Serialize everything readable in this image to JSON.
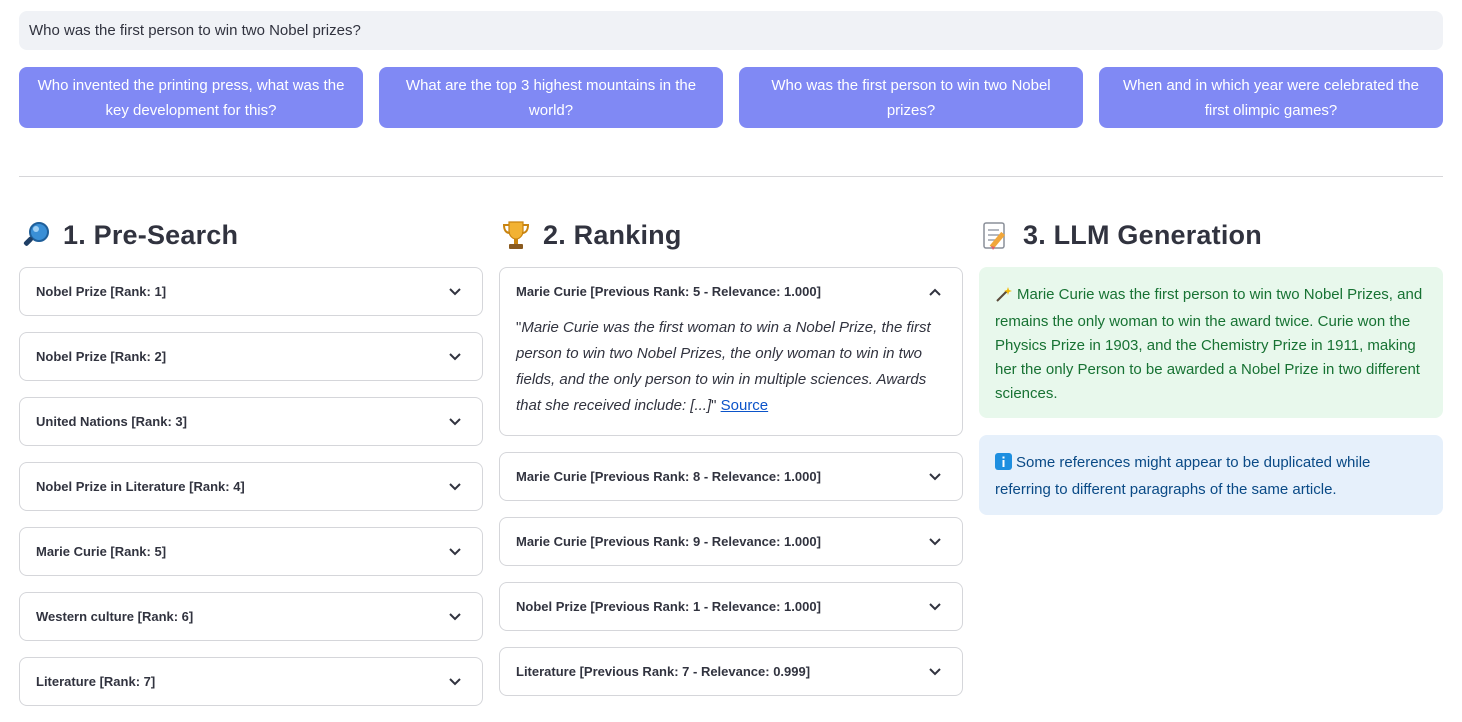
{
  "query": {
    "value": "Who was the first person to win two Nobel prizes?"
  },
  "suggestions": [
    "Who invented the printing press, what was the key development for this?",
    "What are the top 3 highest mountains in the world?",
    "Who was the first person to win two Nobel prizes?",
    "When and in which year were celebrated the first olimpic games?"
  ],
  "presearch": {
    "title": "1. Pre-Search",
    "icon": "magnifier-icon",
    "items": [
      "Nobel Prize [Rank: 1]",
      "Nobel Prize [Rank: 2]",
      "United Nations [Rank: 3]",
      "Nobel Prize in Literature [Rank: 4]",
      "Marie Curie [Rank: 5]",
      "Western culture [Rank: 6]",
      "Literature [Rank: 7]"
    ]
  },
  "ranking": {
    "title": "2. Ranking",
    "icon": "trophy-icon",
    "expanded": {
      "label": "Marie Curie [Previous Rank: 5 - Relevance: 1.000]",
      "quote_open": "\"",
      "quote": "Marie Curie was the first woman to win a Nobel Prize, the first person to win two Nobel Prizes, the only woman to win in two fields, and the only person to win in multiple sciences. Awards that she received include: [...]",
      "quote_close": "\"",
      "source_label": "Source"
    },
    "items": [
      "Marie Curie [Previous Rank: 8 - Relevance: 1.000]",
      "Marie Curie [Previous Rank: 9 - Relevance: 1.000]",
      "Nobel Prize [Previous Rank: 1 - Relevance: 1.000]",
      "Literature [Previous Rank: 7 - Relevance: 0.999]"
    ]
  },
  "generation": {
    "title": "3. LLM Generation",
    "icon": "memo-icon",
    "answer": "Marie Curie was the first person to win two Nobel Prizes, and remains the only woman to win the award twice. Curie won the Physics Prize in 1903, and the Chemistry Prize in 1911, making her the only Person to be awarded a Nobel Prize in two different sciences.",
    "answer_icon": "magic-wand-icon",
    "info": "Some references might appear to be duplicated while referring to different paragraphs of the same article.",
    "info_icon": "info-icon"
  },
  "colors": {
    "suggestion_bg": "#8089f4",
    "answer_bg": "#e8f8ec",
    "answer_text": "#177233",
    "info_bg": "#e6f0fb",
    "info_text": "#0a4a86",
    "link": "#0b53c9"
  }
}
